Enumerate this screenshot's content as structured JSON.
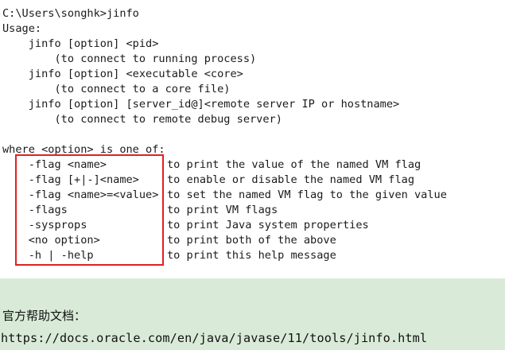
{
  "terminal": {
    "prompt_line": "C:\\Users\\songhk>jinfo",
    "usage_header": "Usage:",
    "usage": [
      {
        "command": "    jinfo [option] <pid>",
        "note": "        (to connect to running process)"
      },
      {
        "command": "    jinfo [option] <executable <core>",
        "note": "        (to connect to a core file)"
      },
      {
        "command": "    jinfo [option] [server_id@]<remote server IP or hostname>",
        "note": "        (to connect to remote debug server)"
      }
    ],
    "where_line": "where <option> is one of:",
    "options": [
      {
        "flag": "    -flag <name>",
        "desc": "to print the value of the named VM flag"
      },
      {
        "flag": "    -flag [+|-]<name>",
        "desc": "to enable or disable the named VM flag"
      },
      {
        "flag": "    -flag <name>=<value>",
        "desc": "to set the named VM flag to the given value"
      },
      {
        "flag": "    -flags",
        "desc": "to print VM flags"
      },
      {
        "flag": "    -sysprops",
        "desc": "to print Java system properties"
      },
      {
        "flag": "    <no option>",
        "desc": "to print both of the above"
      },
      {
        "flag": "    -h | -help",
        "desc": "to print this help message"
      }
    ]
  },
  "highlight": {
    "color": "#e02020"
  },
  "footer": {
    "label": "官方帮助文档：",
    "url": "https://docs.oracle.com/en/java/javase/11/tools/jinfo.html",
    "background": "#d9ebd8"
  }
}
